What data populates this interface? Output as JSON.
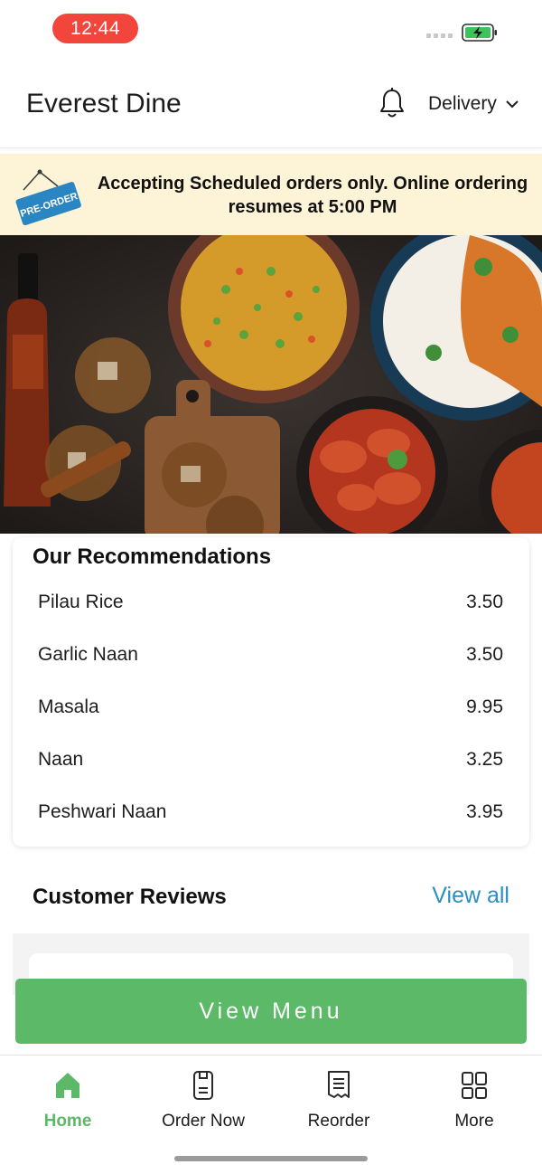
{
  "status_bar": {
    "time": "12:44"
  },
  "header": {
    "title": "Everest Dine",
    "delivery_label": "Delivery",
    "bell_icon": "bell-icon",
    "chevron_icon": "chevron-down-icon"
  },
  "notice": {
    "sign_text": "PRE-ORDER",
    "message": "Accepting Scheduled orders only. Online ordering resumes at 5:00 PM"
  },
  "recommendations": {
    "title": "Our Recommendations",
    "items": [
      {
        "name": "Pilau Rice",
        "price": "3.50"
      },
      {
        "name": "Garlic Naan",
        "price": "3.50"
      },
      {
        "name": "Masala",
        "price": "9.95"
      },
      {
        "name": "Naan",
        "price": "3.25"
      },
      {
        "name": "Peshwari Naan",
        "price": "3.95"
      }
    ]
  },
  "reviews": {
    "title": "Customer Reviews",
    "view_all": "View all"
  },
  "view_menu_label": "View Menu",
  "tabs": [
    {
      "label": "Home",
      "icon": "home-icon",
      "active": true
    },
    {
      "label": "Order Now",
      "icon": "order-icon",
      "active": false
    },
    {
      "label": "Reorder",
      "icon": "receipt-icon",
      "active": false
    },
    {
      "label": "More",
      "icon": "grid-icon",
      "active": false
    }
  ],
  "colors": {
    "accent_green": "#5cb968",
    "link_blue": "#2a8fc0",
    "time_pill_red": "#f2453b",
    "notice_bg": "#fdf3d6"
  }
}
